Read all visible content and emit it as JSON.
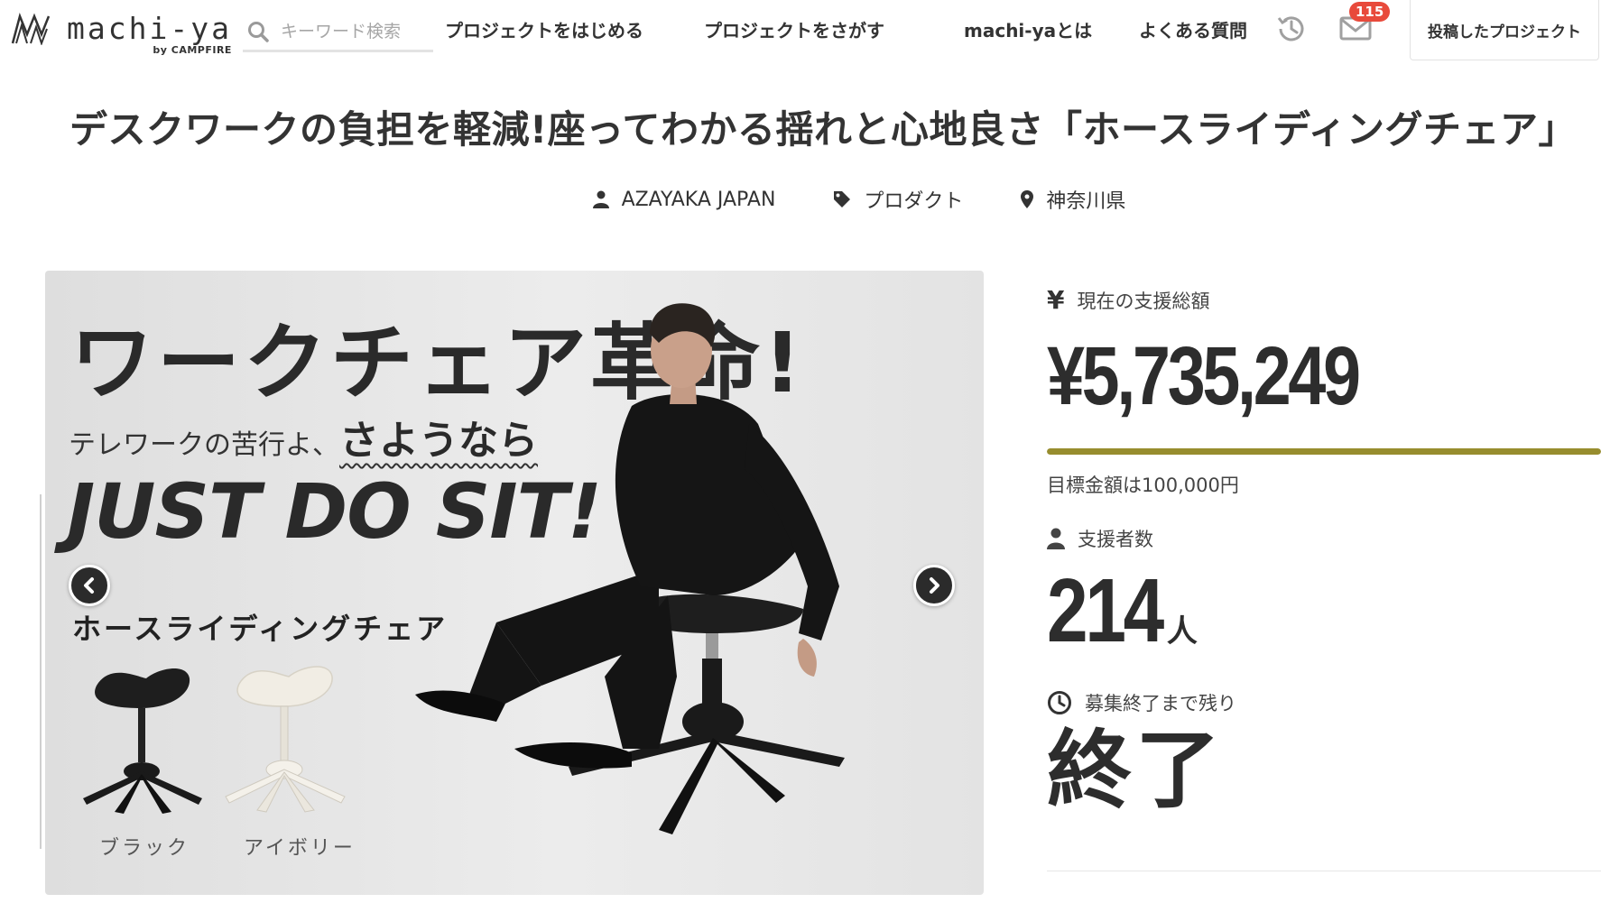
{
  "header": {
    "logo_word": "machi-ya",
    "logo_sub": "by CAMPFIRE",
    "search_placeholder": "キーワード検索",
    "nav": [
      {
        "label": "プロジェクトをはじめる"
      },
      {
        "label": "プロジェクトをさがす"
      },
      {
        "label": "machi-yaとは"
      },
      {
        "label": "よくある質問"
      }
    ],
    "notification_count": "115",
    "posted_projects_label": "投稿したプロジェクト",
    "icons": [
      "search-icon",
      "history-icon",
      "mail-icon"
    ]
  },
  "project": {
    "title": "デスクワークの負担を軽減!座ってわかる揺れと心地良さ「ホースライディングチェア」",
    "owner": "AZAYAKA JAPAN",
    "category": "プロダクト",
    "location": "神奈川県"
  },
  "hero": {
    "headline": "ワークチェア革命!",
    "sub_prefix": "テレワークの苦行よ、",
    "sub_emphasis": "さようなら",
    "slogan": "JUST DO SIT!",
    "product_name": "ホースライディングチェア",
    "color_black": "ブラック",
    "color_ivory": "アイボリー"
  },
  "stats": {
    "total_label": "現在の支援総額",
    "total_amount": "¥5,735,249",
    "progress_percent": 100,
    "goal_text": "目標金額は100,000円",
    "backers_label": "支援者数",
    "backers_count": "214",
    "backers_unit": "人",
    "remaining_label": "募集終了まで残り",
    "remaining_value": "終了",
    "accent_color": "#978d2e"
  }
}
